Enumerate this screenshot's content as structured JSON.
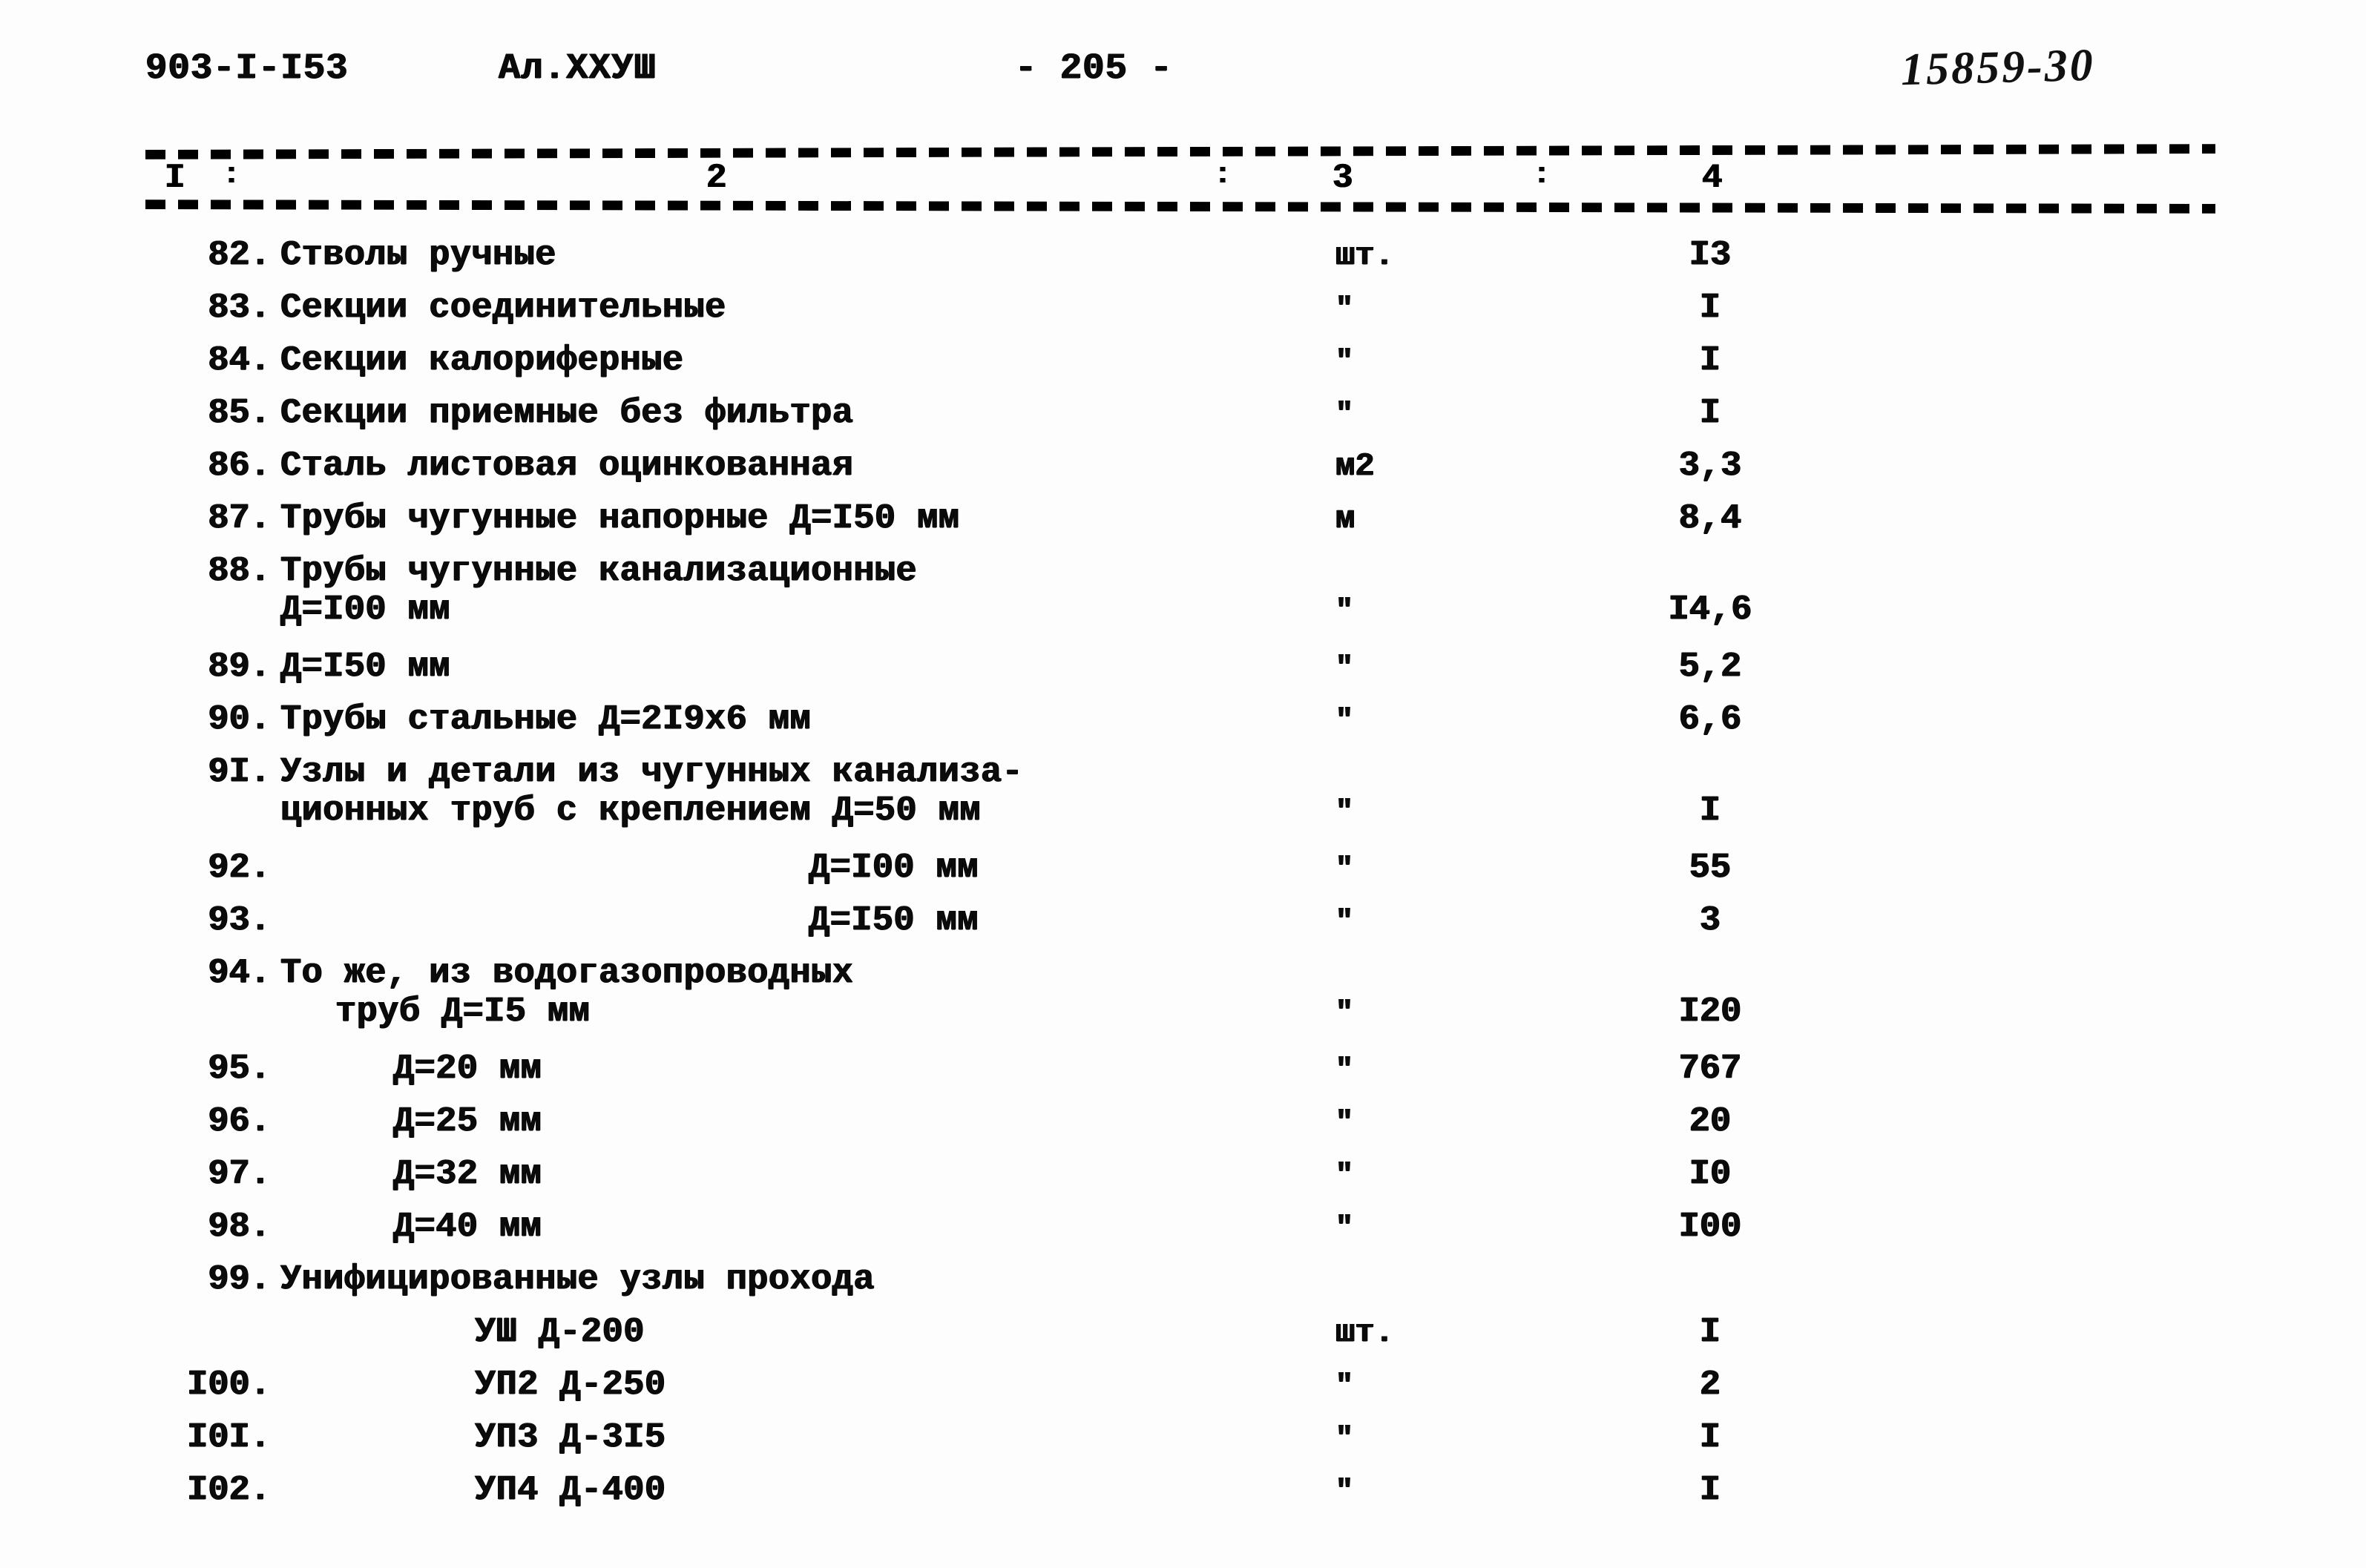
{
  "header": {
    "doc_code": "903-I-I53",
    "album": "Ал.XXУШ",
    "page_marker": "- 205 -",
    "archive_stamp": "15859-30"
  },
  "table": {
    "column_numbers": [
      "I",
      "2",
      "3",
      "4"
    ],
    "separator": ":",
    "rows": [
      {
        "num": "82.",
        "name": "Стволы ручные",
        "name2": "",
        "indent": "ind-0",
        "indent2": "ind-0",
        "unit": "шт.",
        "unit_ditto": false,
        "qty": "I3"
      },
      {
        "num": "83.",
        "name": "Секции соединительные",
        "name2": "",
        "indent": "ind-0",
        "indent2": "ind-0",
        "unit": "\"",
        "unit_ditto": true,
        "qty": "I"
      },
      {
        "num": "84.",
        "name": "Секции калориферные",
        "name2": "",
        "indent": "ind-0",
        "indent2": "ind-0",
        "unit": "\"",
        "unit_ditto": true,
        "qty": "I"
      },
      {
        "num": "85.",
        "name": "Секции приемные без фильтра",
        "name2": "",
        "indent": "ind-0",
        "indent2": "ind-0",
        "unit": "\"",
        "unit_ditto": true,
        "qty": "I"
      },
      {
        "num": "86.",
        "name": "Сталь листовая оцинкованная",
        "name2": "",
        "indent": "ind-0",
        "indent2": "ind-0",
        "unit": "м2",
        "unit_ditto": false,
        "qty": "3,3"
      },
      {
        "num": "87.",
        "name": "Трубы чугунные напорные Д=I50 мм",
        "name2": "",
        "indent": "ind-0",
        "indent2": "ind-0",
        "unit": "м",
        "unit_ditto": false,
        "qty": "8,4"
      },
      {
        "num": "88.",
        "name": "Трубы чугунные канализационные",
        "name2": "Д=I00 мм",
        "indent": "ind-0",
        "indent2": "ind-0",
        "unit": "\"",
        "unit_ditto": true,
        "qty": "I4,6"
      },
      {
        "num": "89.",
        "name": "Д=I50 мм",
        "name2": "",
        "indent": "ind-0",
        "indent2": "ind-0",
        "unit": "\"",
        "unit_ditto": true,
        "qty": "5,2"
      },
      {
        "num": "90.",
        "name": "Трубы стальные Д=2I9х6 мм",
        "name2": "",
        "indent": "ind-0",
        "indent2": "ind-0",
        "unit": "\"",
        "unit_ditto": true,
        "qty": "6,6"
      },
      {
        "num": "9I.",
        "name": "Узлы и детали из чугунных канализа-",
        "name2": "ционных труб с креплением Д=50 мм",
        "indent": "ind-0",
        "indent2": "ind-0",
        "unit": "\"",
        "unit_ditto": true,
        "qty": "I"
      },
      {
        "num": "92.",
        "name": "Д=I00 мм",
        "name2": "",
        "indent": "ind-r",
        "indent2": "ind-0",
        "unit": "\"",
        "unit_ditto": true,
        "qty": "55"
      },
      {
        "num": "93.",
        "name": "Д=I50 мм",
        "name2": "",
        "indent": "ind-r",
        "indent2": "ind-0",
        "unit": "\"",
        "unit_ditto": true,
        "qty": "3"
      },
      {
        "num": "94.",
        "name": "То же, из водогазопроводных",
        "name2": "труб Д=I5 мм",
        "indent": "ind-0",
        "indent2": "ind-1",
        "unit": "\"",
        "unit_ditto": true,
        "qty": "I20"
      },
      {
        "num": "95.",
        "name": "Д=20 мм",
        "name2": "",
        "indent": "ind-2",
        "indent2": "ind-0",
        "unit": "\"",
        "unit_ditto": true,
        "qty": "767"
      },
      {
        "num": "96.",
        "name": "Д=25 мм",
        "name2": "",
        "indent": "ind-2",
        "indent2": "ind-0",
        "unit": "\"",
        "unit_ditto": true,
        "qty": "20"
      },
      {
        "num": "97.",
        "name": "Д=32 мм",
        "name2": "",
        "indent": "ind-2",
        "indent2": "ind-0",
        "unit": "\"",
        "unit_ditto": true,
        "qty": "I0"
      },
      {
        "num": "98.",
        "name": "Д=40 мм",
        "name2": "",
        "indent": "ind-2",
        "indent2": "ind-0",
        "unit": "\"",
        "unit_ditto": true,
        "qty": "I00"
      },
      {
        "num": "99.",
        "name": "Унифицированные узлы прохода",
        "name2": "",
        "indent": "ind-0",
        "indent2": "ind-0",
        "unit": "",
        "unit_ditto": false,
        "qty": ""
      },
      {
        "num": "",
        "name": "УШ Д-200",
        "name2": "",
        "indent": "ind-u",
        "indent2": "ind-0",
        "unit": "шт.",
        "unit_ditto": false,
        "qty": "I"
      },
      {
        "num": "I00.",
        "name": "УП2 Д-250",
        "name2": "",
        "indent": "ind-u",
        "indent2": "ind-0",
        "unit": "\"",
        "unit_ditto": true,
        "qty": "2"
      },
      {
        "num": "I0I.",
        "name": "УП3 Д-3I5",
        "name2": "",
        "indent": "ind-u",
        "indent2": "ind-0",
        "unit": "\"",
        "unit_ditto": true,
        "qty": "I"
      },
      {
        "num": "I02.",
        "name": "УП4 Д-400",
        "name2": "",
        "indent": "ind-u",
        "indent2": "ind-0",
        "unit": "\"",
        "unit_ditto": true,
        "qty": "I"
      }
    ]
  }
}
